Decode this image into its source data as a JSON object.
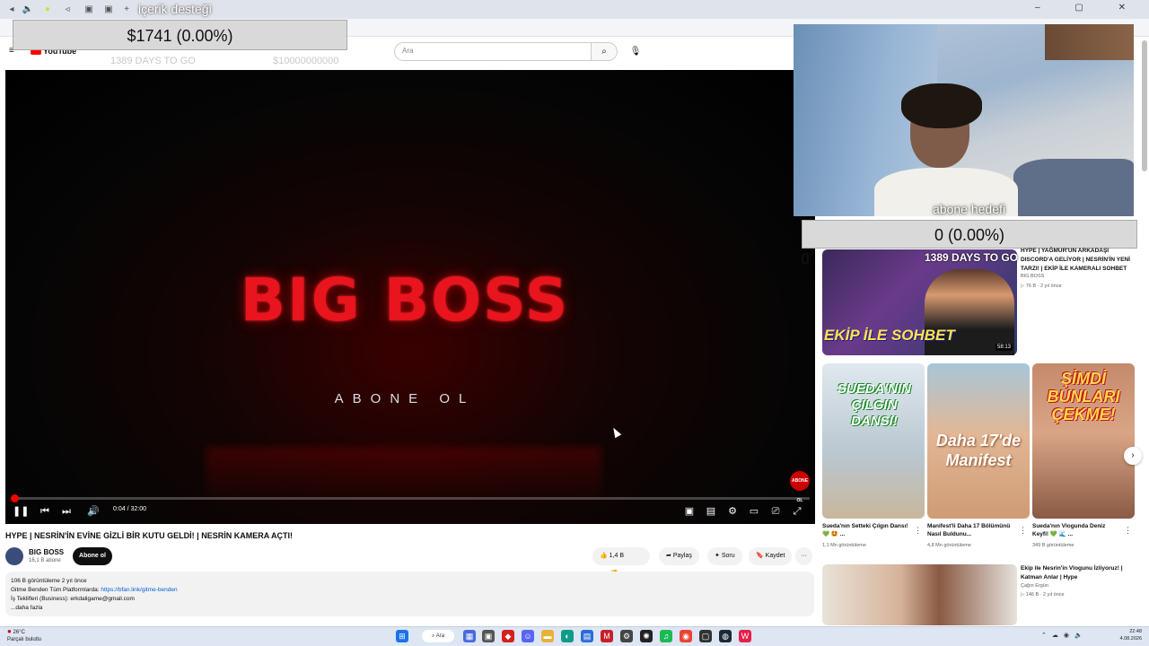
{
  "browser": {
    "overlay_title": "içerik desteği",
    "window_controls": "– ▢ ✕"
  },
  "youtube": {
    "logo": "YouTube",
    "search_placeholder": "Ara"
  },
  "overlays": {
    "money": "$1741 (0.00%)",
    "days_to_go": "1389 DAYS TO GO",
    "goal_ghost": "$10000000000",
    "abone_hedefi": "abone hedefi",
    "goal_value": "0 (0.00%)",
    "zero": "0"
  },
  "player": {
    "art_title": "BIG BOSS",
    "art_subtitle": "ABONE OL",
    "time": "0:04 / 32:00",
    "progress_fraction": 0.002,
    "watermark": "ABONE OL"
  },
  "video": {
    "title": "HYPE | NESRİN'İN EVİNE GİZLİ BİR KUTU GELDİ! | NESRİN KAMERA AÇTI!",
    "channel": "BIG BOSS",
    "subscribers": "16,1 B abone",
    "subscribe_label": "Abone ol",
    "likes": "1,4 B",
    "share_label": "Paylaş",
    "ask_label": "Soru",
    "save_label": "Kaydet",
    "description": {
      "stats": "106 B görüntüleme  2 yıl önce",
      "line1_prefix": "Gitme Benden Tüm Platformlarda:",
      "line1_link": "https://bfan.link/gitme-benden",
      "line2": "İş Teklifleri (Business): erkdaligame@gmail.com",
      "more": "...daha fazla"
    }
  },
  "sidebar": {
    "rec1": {
      "thumb_days": "1389 DAYS TO GO",
      "thumb_text": "EKİP İLE SOHBET",
      "duration": "58:13",
      "title": "HYPE | YAĞMUR'UN ARKADAŞI DISCORD'A GELİYOR | NESRİN'İN YENİ TARZI! | EKİP İLE KAMERALI SOHBET",
      "channel": "BIG BOSS",
      "meta": "▷ 76 B · 2 yıl önce"
    },
    "shorts": [
      {
        "art": "SUEDA'NIN ÇILGIN DANSI!",
        "title": "Sueda'nın Setteki Çılgın Dansı! 💚 🤩 ...",
        "views": "1,1 Mn görüntüleme"
      },
      {
        "art": "Daha 17'de Manifest",
        "title": "Manifest'li Daha 17 Bölümünü Nasıl Buldunu...",
        "views": "4,8 Mn görüntüleme"
      },
      {
        "art": "ŞİMDİ BUNLARI ÇEKME!",
        "title": "Sueda'nın Vlogunda Deniz Keyfi! 💚 🌊 ...",
        "views": "349 B görüntüleme"
      }
    ],
    "rec2": {
      "title": "Ekip ile Nesrin'in Vlogunu İzliyoruz! | Katman Anlar | Hype",
      "channel": "Çağın Ergün",
      "meta": "▷ 146 B · 2 yıl önce"
    }
  },
  "taskbar": {
    "weather_temp": "26°C",
    "weather_desc": "Parçalı bulutlu",
    "search_label": "Ara",
    "clock_time": "22:48",
    "clock_date": "4.08.2026"
  },
  "colors": {
    "accent_red": "#ff0000",
    "goal_box": "#d9d9d9"
  }
}
